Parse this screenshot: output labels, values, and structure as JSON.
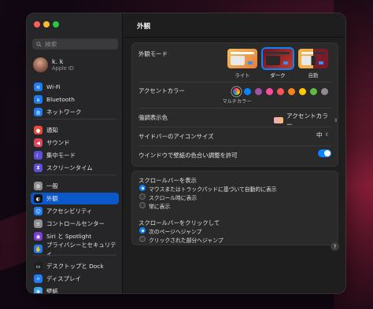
{
  "search": {
    "placeholder": "検索"
  },
  "profile": {
    "name": "k. k",
    "sub": "Apple ID"
  },
  "sidebar": {
    "group1": [
      {
        "label": "Wi-Fi",
        "icon": "wifi-icon",
        "color": "#1e7cf2",
        "glyph": "≋"
      },
      {
        "label": "Bluetooth",
        "icon": "bluetooth-icon",
        "color": "#1e7cf2",
        "glyph": "ʙ"
      },
      {
        "label": "ネットワーク",
        "icon": "globe-icon",
        "color": "#1e7cf2",
        "glyph": "◍"
      }
    ],
    "group2": [
      {
        "label": "通知",
        "icon": "bell-icon",
        "color": "#eb4b3d",
        "glyph": "●"
      },
      {
        "label": "サウンド",
        "icon": "speaker-icon",
        "color": "#e0445a",
        "glyph": "◀"
      },
      {
        "label": "集中モード",
        "icon": "moon-icon",
        "color": "#5d4ed6",
        "glyph": "☾"
      },
      {
        "label": "スクリーンタイム",
        "icon": "hourglass-icon",
        "color": "#5d4ed6",
        "glyph": "⧗"
      }
    ],
    "group3": [
      {
        "label": "一般",
        "icon": "gear-icon",
        "color": "#8e8e93",
        "glyph": "⚙"
      },
      {
        "label": "外観",
        "icon": "appearance-icon",
        "color": "#111111",
        "glyph": "◐",
        "selected": true
      },
      {
        "label": "アクセシビリティ",
        "icon": "accessibility-icon",
        "color": "#1e7cf2",
        "glyph": "☺"
      },
      {
        "label": "コントロールセンター",
        "icon": "control-center-icon",
        "color": "#8e8e93",
        "glyph": "≡"
      },
      {
        "label": "Siri と Spotlight",
        "icon": "siri-icon",
        "color": "#7a3fd6",
        "glyph": "◉"
      },
      {
        "label": "プライバシーとセキュリティ",
        "icon": "hand-icon",
        "color": "#1e7cf2",
        "glyph": "✋"
      }
    ],
    "group4": [
      {
        "label": "デスクトップと Dock",
        "icon": "dock-icon",
        "color": "#1f1f1f",
        "glyph": "▭"
      },
      {
        "label": "ディスプレイ",
        "icon": "display-icon",
        "color": "#1e7cf2",
        "glyph": "☼"
      },
      {
        "label": "壁紙",
        "icon": "wallpaper-icon",
        "color": "#3aa0e8",
        "glyph": "❀"
      }
    ]
  },
  "main": {
    "title": "外観",
    "appearance_mode_label": "外観モード",
    "modes": [
      {
        "label": "ライト",
        "selected": false
      },
      {
        "label": "ダーク",
        "selected": true
      },
      {
        "label": "自動",
        "selected": false
      }
    ],
    "accent_label": "アクセントカラー",
    "accent_colors": [
      "multicolor",
      "#0a84ff",
      "#a550a7",
      "#f74f9e",
      "#ff5257",
      "#f7821b",
      "#ffc600",
      "#62ba46",
      "#8c8c8c"
    ],
    "accent_caption": "マルチカラー",
    "highlight_label": "強調表示色",
    "highlight_value": "アクセントカラー",
    "sidebar_icon_label": "サイドバーのアイコンサイズ",
    "sidebar_icon_value": "中",
    "tint_label": "ウインドウで壁紙の色合い調整を許可",
    "tint_on": true,
    "show_scrollbars_label": "スクロールバーを表示",
    "show_scrollbars_options": [
      {
        "label": "マウスまたはトラックパッドに基づいて自動的に表示",
        "selected": true
      },
      {
        "label": "スクロール時に表示",
        "selected": false
      },
      {
        "label": "常に表示",
        "selected": false
      }
    ],
    "click_scrollbar_label": "スクロールバーをクリックして",
    "click_scrollbar_options": [
      {
        "label": "次のページへジャンプ",
        "selected": true
      },
      {
        "label": "クリックされた部分へジャンプ",
        "selected": false
      }
    ],
    "help": "?"
  }
}
